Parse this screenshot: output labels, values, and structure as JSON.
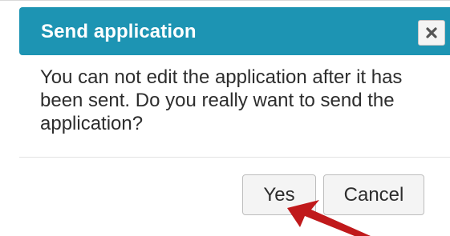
{
  "dialog": {
    "title": "Send application",
    "message": "You can not edit the application after it has been sent. Do you really want to send the application?",
    "header_color": "#1d94b3",
    "close_icon": "close-icon"
  },
  "buttons": {
    "yes_label": "Yes",
    "cancel_label": "Cancel"
  },
  "annotation": {
    "arrow_color": "#c0191b",
    "icon": "arrow-pointer-icon"
  }
}
